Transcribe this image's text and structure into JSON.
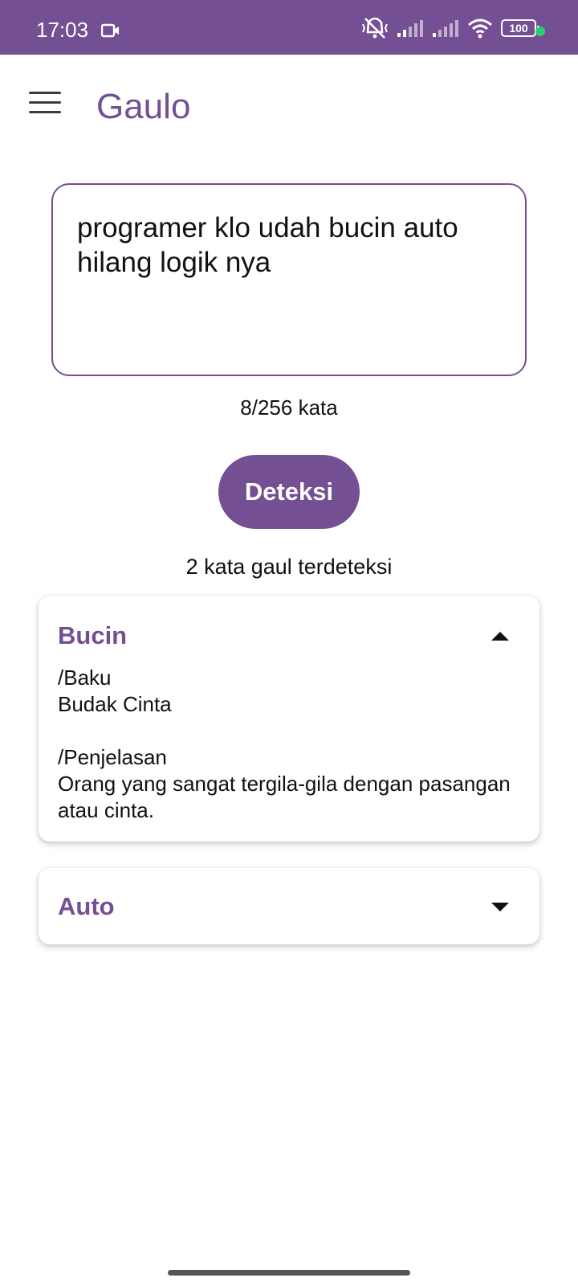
{
  "status_bar": {
    "time": "17:03",
    "battery": "100",
    "colors": {
      "bar": "#744f93",
      "dot": "#2ecc71"
    }
  },
  "app_bar": {
    "title": "Gaulo"
  },
  "input": {
    "text": "programer klo udah bucin auto hilang logik nya"
  },
  "word_count": "8/256 kata",
  "detect_button": {
    "label": "Deteksi"
  },
  "result_summary": "2 kata gaul terdeteksi",
  "results": [
    {
      "word": "Bucin",
      "expanded": true,
      "baku_label": "/Baku",
      "baku": "Budak Cinta",
      "penjelasan_label": "/Penjelasan",
      "penjelasan": "Orang yang sangat tergila-gila dengan pasangan atau cinta."
    },
    {
      "word": "Auto",
      "expanded": false
    }
  ],
  "theme": {
    "accent": "#744f93"
  }
}
